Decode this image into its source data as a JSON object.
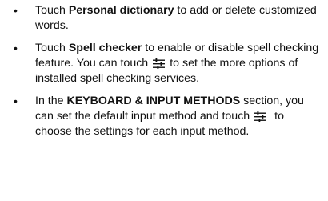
{
  "bullets": [
    {
      "segments": {
        "t1": "Touch ",
        "b1": "Personal dictionary",
        "t2": " to add or delete customized words."
      }
    },
    {
      "segments": {
        "t1": "Touch ",
        "b1": "Spell checker",
        "t2": " to enable or disable spell checking feature. You can touch",
        "icon": "settings-sliders-icon",
        "t3": "to set the more options of installed spell checking services."
      }
    },
    {
      "segments": {
        "t1": "In the ",
        "b1": "KEYBOARD & INPUT METHODS",
        "t2": " section, you can set the default input method and touch",
        "icon": "settings-sliders-icon",
        "t3": " to choose the settings for each input method."
      }
    }
  ],
  "colors": {
    "text": "#111111",
    "icon": "#111111",
    "background": "#ffffff"
  }
}
